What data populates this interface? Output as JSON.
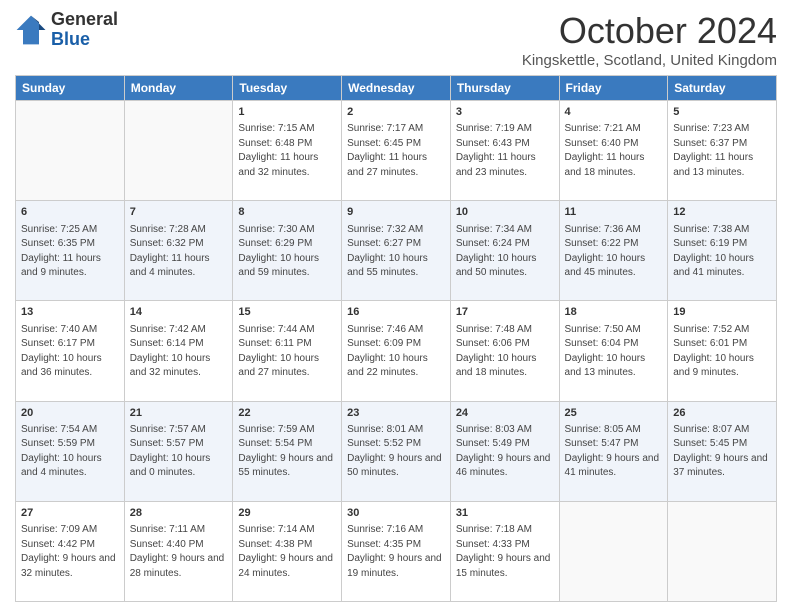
{
  "logo": {
    "general": "General",
    "blue": "Blue"
  },
  "header": {
    "month": "October 2024",
    "location": "Kingskettle, Scotland, United Kingdom"
  },
  "weekdays": [
    "Sunday",
    "Monday",
    "Tuesday",
    "Wednesday",
    "Thursday",
    "Friday",
    "Saturday"
  ],
  "weeks": [
    [
      {
        "day": "",
        "sunrise": "",
        "sunset": "",
        "daylight": ""
      },
      {
        "day": "",
        "sunrise": "",
        "sunset": "",
        "daylight": ""
      },
      {
        "day": "1",
        "sunrise": "Sunrise: 7:15 AM",
        "sunset": "Sunset: 6:48 PM",
        "daylight": "Daylight: 11 hours and 32 minutes."
      },
      {
        "day": "2",
        "sunrise": "Sunrise: 7:17 AM",
        "sunset": "Sunset: 6:45 PM",
        "daylight": "Daylight: 11 hours and 27 minutes."
      },
      {
        "day": "3",
        "sunrise": "Sunrise: 7:19 AM",
        "sunset": "Sunset: 6:43 PM",
        "daylight": "Daylight: 11 hours and 23 minutes."
      },
      {
        "day": "4",
        "sunrise": "Sunrise: 7:21 AM",
        "sunset": "Sunset: 6:40 PM",
        "daylight": "Daylight: 11 hours and 18 minutes."
      },
      {
        "day": "5",
        "sunrise": "Sunrise: 7:23 AM",
        "sunset": "Sunset: 6:37 PM",
        "daylight": "Daylight: 11 hours and 13 minutes."
      }
    ],
    [
      {
        "day": "6",
        "sunrise": "Sunrise: 7:25 AM",
        "sunset": "Sunset: 6:35 PM",
        "daylight": "Daylight: 11 hours and 9 minutes."
      },
      {
        "day": "7",
        "sunrise": "Sunrise: 7:28 AM",
        "sunset": "Sunset: 6:32 PM",
        "daylight": "Daylight: 11 hours and 4 minutes."
      },
      {
        "day": "8",
        "sunrise": "Sunrise: 7:30 AM",
        "sunset": "Sunset: 6:29 PM",
        "daylight": "Daylight: 10 hours and 59 minutes."
      },
      {
        "day": "9",
        "sunrise": "Sunrise: 7:32 AM",
        "sunset": "Sunset: 6:27 PM",
        "daylight": "Daylight: 10 hours and 55 minutes."
      },
      {
        "day": "10",
        "sunrise": "Sunrise: 7:34 AM",
        "sunset": "Sunset: 6:24 PM",
        "daylight": "Daylight: 10 hours and 50 minutes."
      },
      {
        "day": "11",
        "sunrise": "Sunrise: 7:36 AM",
        "sunset": "Sunset: 6:22 PM",
        "daylight": "Daylight: 10 hours and 45 minutes."
      },
      {
        "day": "12",
        "sunrise": "Sunrise: 7:38 AM",
        "sunset": "Sunset: 6:19 PM",
        "daylight": "Daylight: 10 hours and 41 minutes."
      }
    ],
    [
      {
        "day": "13",
        "sunrise": "Sunrise: 7:40 AM",
        "sunset": "Sunset: 6:17 PM",
        "daylight": "Daylight: 10 hours and 36 minutes."
      },
      {
        "day": "14",
        "sunrise": "Sunrise: 7:42 AM",
        "sunset": "Sunset: 6:14 PM",
        "daylight": "Daylight: 10 hours and 32 minutes."
      },
      {
        "day": "15",
        "sunrise": "Sunrise: 7:44 AM",
        "sunset": "Sunset: 6:11 PM",
        "daylight": "Daylight: 10 hours and 27 minutes."
      },
      {
        "day": "16",
        "sunrise": "Sunrise: 7:46 AM",
        "sunset": "Sunset: 6:09 PM",
        "daylight": "Daylight: 10 hours and 22 minutes."
      },
      {
        "day": "17",
        "sunrise": "Sunrise: 7:48 AM",
        "sunset": "Sunset: 6:06 PM",
        "daylight": "Daylight: 10 hours and 18 minutes."
      },
      {
        "day": "18",
        "sunrise": "Sunrise: 7:50 AM",
        "sunset": "Sunset: 6:04 PM",
        "daylight": "Daylight: 10 hours and 13 minutes."
      },
      {
        "day": "19",
        "sunrise": "Sunrise: 7:52 AM",
        "sunset": "Sunset: 6:01 PM",
        "daylight": "Daylight: 10 hours and 9 minutes."
      }
    ],
    [
      {
        "day": "20",
        "sunrise": "Sunrise: 7:54 AM",
        "sunset": "Sunset: 5:59 PM",
        "daylight": "Daylight: 10 hours and 4 minutes."
      },
      {
        "day": "21",
        "sunrise": "Sunrise: 7:57 AM",
        "sunset": "Sunset: 5:57 PM",
        "daylight": "Daylight: 10 hours and 0 minutes."
      },
      {
        "day": "22",
        "sunrise": "Sunrise: 7:59 AM",
        "sunset": "Sunset: 5:54 PM",
        "daylight": "Daylight: 9 hours and 55 minutes."
      },
      {
        "day": "23",
        "sunrise": "Sunrise: 8:01 AM",
        "sunset": "Sunset: 5:52 PM",
        "daylight": "Daylight: 9 hours and 50 minutes."
      },
      {
        "day": "24",
        "sunrise": "Sunrise: 8:03 AM",
        "sunset": "Sunset: 5:49 PM",
        "daylight": "Daylight: 9 hours and 46 minutes."
      },
      {
        "day": "25",
        "sunrise": "Sunrise: 8:05 AM",
        "sunset": "Sunset: 5:47 PM",
        "daylight": "Daylight: 9 hours and 41 minutes."
      },
      {
        "day": "26",
        "sunrise": "Sunrise: 8:07 AM",
        "sunset": "Sunset: 5:45 PM",
        "daylight": "Daylight: 9 hours and 37 minutes."
      }
    ],
    [
      {
        "day": "27",
        "sunrise": "Sunrise: 7:09 AM",
        "sunset": "Sunset: 4:42 PM",
        "daylight": "Daylight: 9 hours and 32 minutes."
      },
      {
        "day": "28",
        "sunrise": "Sunrise: 7:11 AM",
        "sunset": "Sunset: 4:40 PM",
        "daylight": "Daylight: 9 hours and 28 minutes."
      },
      {
        "day": "29",
        "sunrise": "Sunrise: 7:14 AM",
        "sunset": "Sunset: 4:38 PM",
        "daylight": "Daylight: 9 hours and 24 minutes."
      },
      {
        "day": "30",
        "sunrise": "Sunrise: 7:16 AM",
        "sunset": "Sunset: 4:35 PM",
        "daylight": "Daylight: 9 hours and 19 minutes."
      },
      {
        "day": "31",
        "sunrise": "Sunrise: 7:18 AM",
        "sunset": "Sunset: 4:33 PM",
        "daylight": "Daylight: 9 hours and 15 minutes."
      },
      {
        "day": "",
        "sunrise": "",
        "sunset": "",
        "daylight": ""
      },
      {
        "day": "",
        "sunrise": "",
        "sunset": "",
        "daylight": ""
      }
    ]
  ]
}
